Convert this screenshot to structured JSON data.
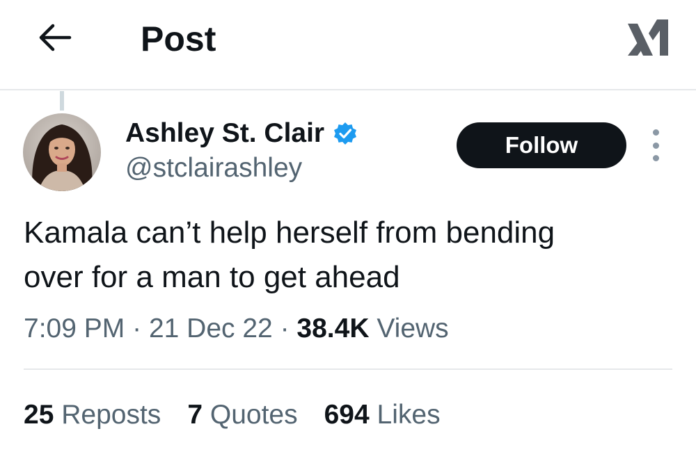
{
  "header": {
    "title": "Post",
    "back_icon": "arrow-left-icon",
    "logo_icon": "x-logo-icon"
  },
  "post": {
    "author": {
      "display_name": "Ashley St. Clair",
      "handle": "@stclairashley",
      "verified": true,
      "verified_color": "#1d9bf0",
      "avatar_icon": "avatar-photo"
    },
    "follow_label": "Follow",
    "more_icon": "more-vertical-icon",
    "text_line1": "Kamala can’t help herself from bending",
    "text_line2": "over for a man to get ahead",
    "time": "7:09 PM",
    "separator": "·",
    "date": "21 Dec 22",
    "views_count": "38.4K",
    "views_label": "Views"
  },
  "stats": {
    "reposts_count": "25",
    "reposts_label": "Reposts",
    "quotes_count": "7",
    "quotes_label": "Quotes",
    "likes_count": "694",
    "likes_label": "Likes"
  },
  "colors": {
    "text_primary": "#0f1419",
    "text_secondary": "#536471",
    "follow_bg": "#0f1419",
    "divider": "#e6e8ea"
  }
}
